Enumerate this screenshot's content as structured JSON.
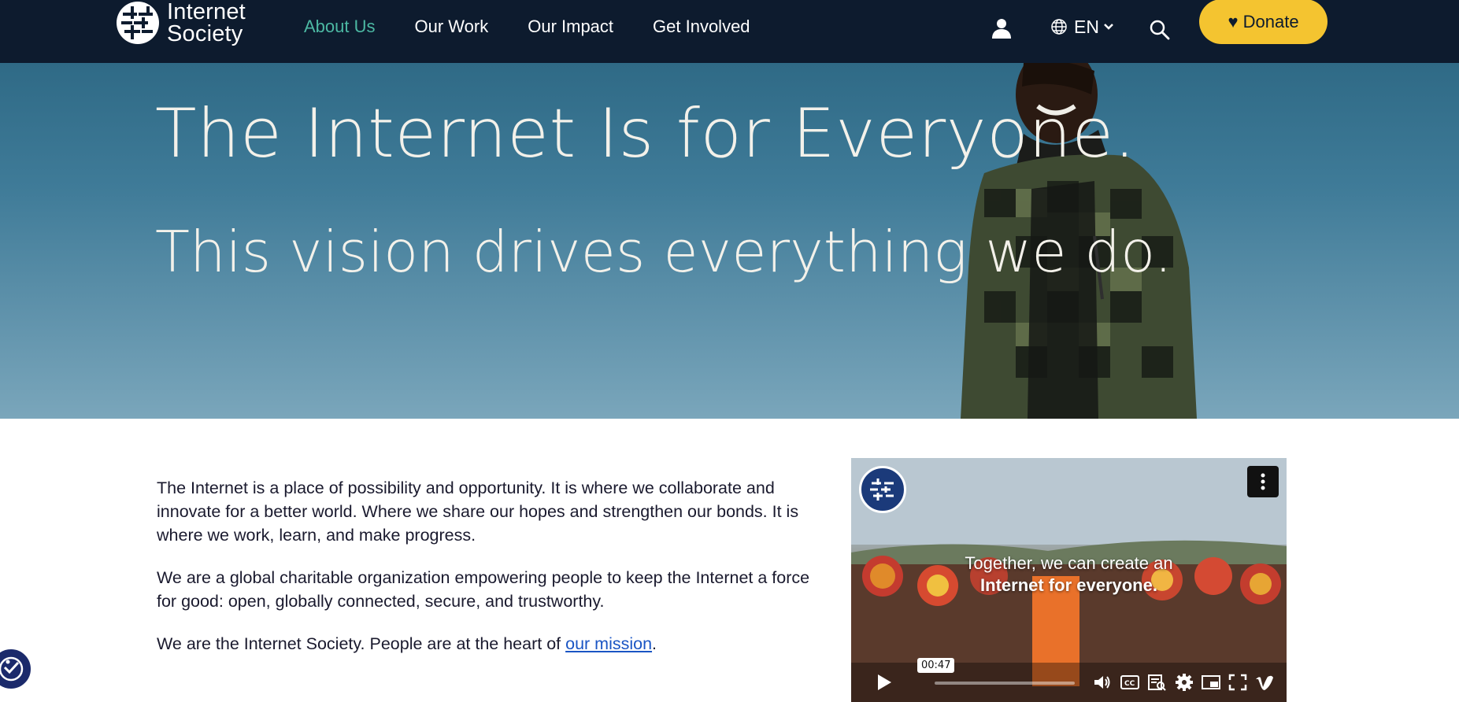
{
  "header": {
    "logo": {
      "line1": "Internet",
      "line2": "Society"
    },
    "nav": [
      {
        "label": "About Us",
        "active": true
      },
      {
        "label": "Our Work",
        "active": false
      },
      {
        "label": "Our Impact",
        "active": false
      },
      {
        "label": "Get Involved",
        "active": false
      }
    ],
    "language": "EN",
    "donate_label": "♥ Donate",
    "icons": [
      "user-icon",
      "globe-icon",
      "chevron-down-icon",
      "search-icon"
    ]
  },
  "hero": {
    "title": "The Internet Is for Everyone.",
    "subtitle": "This vision drives everything we do."
  },
  "content": {
    "paragraphs": [
      "The Internet is a place of possibility and opportunity. It is where we collaborate and innovate for a better world. Where we share our hopes and strengthen our bonds. It is where we work, learn, and make progress.",
      "We are a global charitable organization empowering people to keep the Internet a force for good: open, globally connected, secure, and trustworthy."
    ],
    "last_paragraph_prefix": "We are the Internet Society. People are at the heart of ",
    "mission_link": "our mission",
    "last_paragraph_suffix": "."
  },
  "video": {
    "caption_line1": "Together, we can create an",
    "caption_line2": "Internet for everyone.",
    "time": "00:47",
    "progress": 0
  },
  "colors": {
    "header_bg": "#0d1b2e",
    "nav_active": "#4cb8a3",
    "donate_bg": "#f4c430",
    "link": "#1a55c4"
  }
}
